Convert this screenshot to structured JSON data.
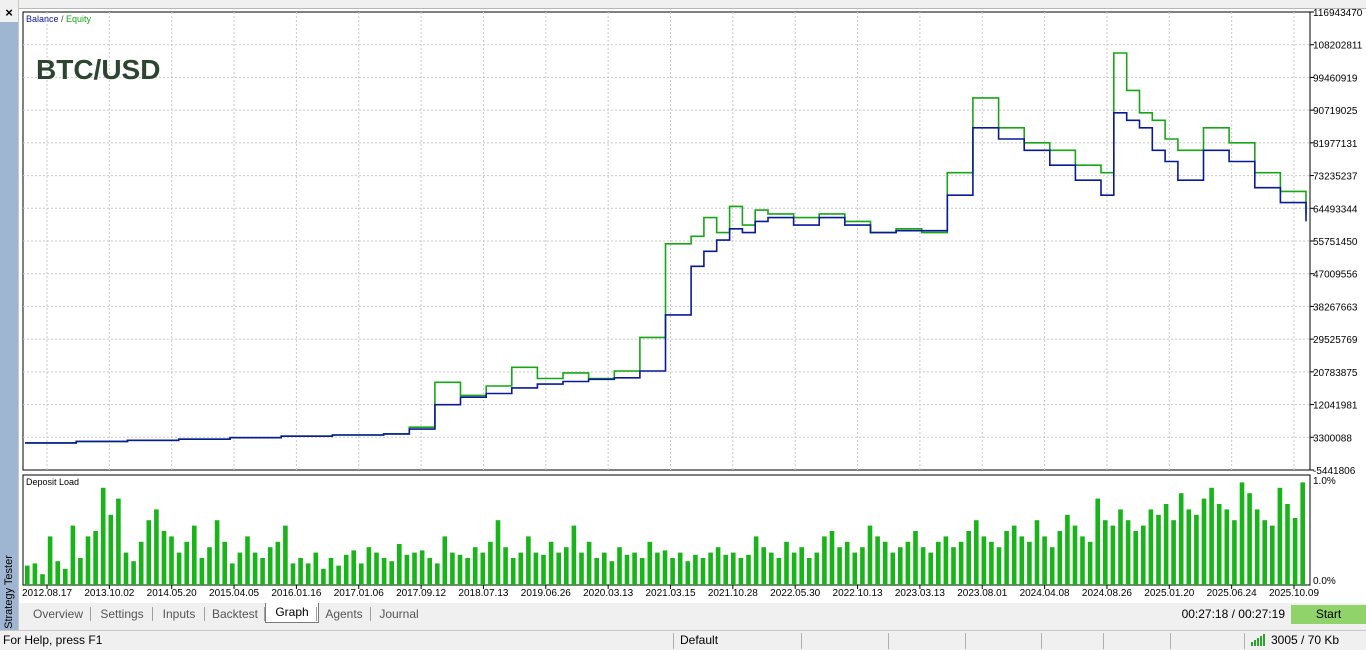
{
  "window": {
    "panel_label": "Strategy Tester",
    "close_glyph": "×"
  },
  "chart": {
    "symbol": "BTC/USD",
    "legend": {
      "balance": "Balance",
      "sep": " / ",
      "equity": "Equity"
    },
    "colors": {
      "balance": "#0a1a96",
      "equity": "#19a519",
      "deposit": "#19b419",
      "grid": "#c8c8c8",
      "axis": "#000000"
    }
  },
  "chart_data": [
    {
      "type": "line",
      "title": "",
      "ylabel": "",
      "y_ticks": [
        "116943470",
        "108202811",
        "99460919",
        "90719025",
        "81977131",
        "73235237",
        "64493344",
        "55751450",
        "47009556",
        "38267663",
        "29525769",
        "20783875",
        "12041981",
        "3300088",
        "-5441806"
      ],
      "ylim": [
        -5441806,
        116943470
      ],
      "series": [
        {
          "name": "Balance",
          "x": [
            0,
            4,
            8,
            12,
            16,
            20,
            24,
            28,
            30,
            32,
            34,
            36,
            38,
            40,
            42,
            44,
            46,
            48,
            50,
            52,
            53,
            54,
            55,
            56,
            57,
            58,
            60,
            62,
            64,
            66,
            68,
            70,
            72,
            74,
            76,
            78,
            80,
            82,
            84,
            85,
            86,
            87,
            88,
            89,
            90,
            92,
            94,
            96,
            98,
            100
          ],
          "y": [
            1800000,
            2200000,
            2500000,
            2800000,
            3200000,
            3600000,
            3900000,
            4200000,
            5500000,
            12000000,
            14000000,
            15000000,
            16500000,
            17500000,
            18200000,
            18800000,
            19200000,
            21000000,
            36000000,
            49000000,
            53000000,
            56000000,
            59000000,
            58000000,
            61000000,
            62000000,
            60000000,
            62000000,
            60000000,
            58000000,
            58500000,
            58500000,
            68000000,
            86000000,
            83000000,
            80000000,
            76000000,
            72000000,
            68000000,
            90000000,
            88000000,
            86000000,
            80000000,
            77000000,
            72000000,
            80000000,
            77000000,
            70000000,
            66000000,
            61000000
          ]
        },
        {
          "name": "Equity",
          "x": [
            0,
            4,
            8,
            12,
            16,
            20,
            24,
            28,
            30,
            32,
            34,
            36,
            38,
            40,
            42,
            44,
            46,
            48,
            50,
            52,
            53,
            54,
            55,
            56,
            57,
            58,
            60,
            62,
            64,
            66,
            68,
            70,
            72,
            74,
            76,
            78,
            80,
            82,
            84,
            85,
            86,
            87,
            88,
            89,
            90,
            92,
            94,
            96,
            98,
            100
          ],
          "y": [
            1800000,
            2200000,
            2500000,
            2800000,
            3200000,
            3600000,
            3900000,
            4200000,
            6000000,
            18000000,
            14500000,
            17000000,
            22000000,
            19000000,
            20500000,
            19000000,
            21000000,
            30000000,
            55000000,
            57000000,
            62000000,
            58000000,
            65000000,
            60000000,
            64000000,
            63000000,
            62000000,
            63000000,
            61000000,
            58000000,
            59000000,
            58000000,
            74000000,
            94000000,
            86000000,
            82000000,
            80000000,
            76000000,
            74000000,
            106000000,
            96000000,
            90000000,
            88000000,
            83000000,
            80000000,
            86000000,
            82000000,
            74000000,
            69000000,
            63000000
          ]
        }
      ]
    },
    {
      "type": "bar",
      "title": "Deposit Load",
      "y_ticks": [
        "1.0%",
        "0.0%"
      ],
      "ylim": [
        0,
        1.0
      ],
      "x_ticks": [
        "2012.08.17",
        "2013.10.02",
        "2014.05.20",
        "2015.04.05",
        "2016.01.16",
        "2017.01.06",
        "2017.09.12",
        "2018.07.13",
        "2019.06.26",
        "2020.03.13",
        "2021.03.15",
        "2021.10.28",
        "2022.05.30",
        "2022.10.13",
        "2023.03.13",
        "2023.08.01",
        "2024.04.08",
        "2024.08.26",
        "2025.01.20",
        "2025.06.24",
        "2025.10.09"
      ],
      "values": [
        0.18,
        0.2,
        0.1,
        0.45,
        0.22,
        0.15,
        0.55,
        0.25,
        0.45,
        0.5,
        0.9,
        0.65,
        0.8,
        0.3,
        0.22,
        0.4,
        0.6,
        0.7,
        0.5,
        0.45,
        0.3,
        0.4,
        0.55,
        0.25,
        0.35,
        0.6,
        0.4,
        0.2,
        0.3,
        0.45,
        0.3,
        0.25,
        0.35,
        0.4,
        0.55,
        0.2,
        0.25,
        0.2,
        0.3,
        0.15,
        0.25,
        0.18,
        0.28,
        0.32,
        0.2,
        0.35,
        0.3,
        0.25,
        0.22,
        0.38,
        0.28,
        0.3,
        0.32,
        0.25,
        0.2,
        0.45,
        0.3,
        0.28,
        0.25,
        0.35,
        0.3,
        0.4,
        0.6,
        0.35,
        0.25,
        0.3,
        0.45,
        0.3,
        0.28,
        0.4,
        0.3,
        0.35,
        0.55,
        0.3,
        0.4,
        0.25,
        0.3,
        0.22,
        0.35,
        0.28,
        0.3,
        0.25,
        0.4,
        0.3,
        0.32,
        0.25,
        0.3,
        0.22,
        0.28,
        0.25,
        0.3,
        0.35,
        0.28,
        0.3,
        0.25,
        0.28,
        0.45,
        0.35,
        0.3,
        0.25,
        0.4,
        0.3,
        0.35,
        0.25,
        0.3,
        0.45,
        0.5,
        0.35,
        0.4,
        0.3,
        0.35,
        0.55,
        0.45,
        0.4,
        0.3,
        0.35,
        0.4,
        0.5,
        0.35,
        0.3,
        0.4,
        0.45,
        0.35,
        0.4,
        0.5,
        0.6,
        0.45,
        0.4,
        0.35,
        0.5,
        0.55,
        0.45,
        0.4,
        0.6,
        0.45,
        0.35,
        0.5,
        0.65,
        0.55,
        0.45,
        0.4,
        0.8,
        0.6,
        0.55,
        0.7,
        0.6,
        0.5,
        0.55,
        0.7,
        0.65,
        0.75,
        0.6,
        0.85,
        0.7,
        0.65,
        0.8,
        0.9,
        0.75,
        0.7,
        0.6,
        0.95,
        0.85,
        0.7,
        0.6,
        0.55,
        0.9,
        0.75,
        0.62,
        0.95
      ]
    }
  ],
  "tabs": [
    "Overview",
    "Settings",
    "Inputs",
    "Backtest",
    "Graph",
    "Agents",
    "Journal"
  ],
  "active_tab": "Graph",
  "timer": "00:27:18 / 00:27:19",
  "start_label": "Start",
  "status": {
    "help": "For Help, press F1",
    "profile": "Default",
    "connection": "3005 / 70 Kb"
  }
}
